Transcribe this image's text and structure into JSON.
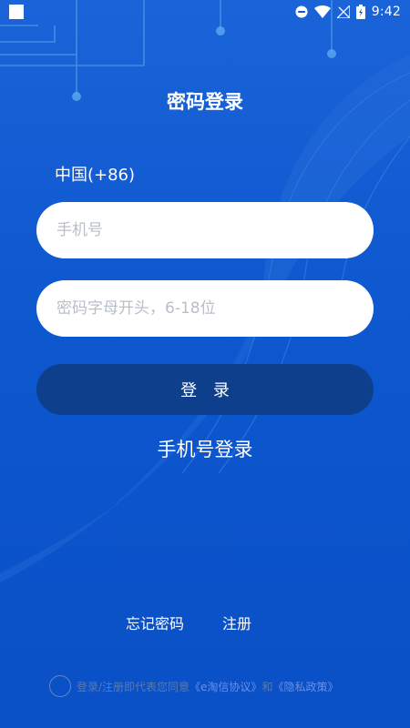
{
  "status_bar": {
    "time": "9:42",
    "icons": [
      "app-notification-square-icon",
      "do-not-disturb-icon",
      "wifi-icon",
      "no-signal-icon",
      "battery-icon"
    ]
  },
  "page": {
    "title": "密码登录"
  },
  "form": {
    "country_code": "中国(+86)",
    "phone_placeholder": "手机号",
    "password_placeholder": "密码字母开头，6-18位",
    "login_button": "登 录",
    "phone_login_link": "手机号登录"
  },
  "links": {
    "forgot_password": "忘记密码",
    "register": "注册"
  },
  "agreement": {
    "prefix": "登录/注册即代表您同意",
    "user_agreement": "《e淘信协议》",
    "conjunction": "和",
    "privacy_policy": "《隐私政策》"
  },
  "colors": {
    "background": "#0d57cf",
    "login_button": "#0e3f8c",
    "input_background": "#ffffff",
    "agreement_link": "#6a8fea"
  }
}
